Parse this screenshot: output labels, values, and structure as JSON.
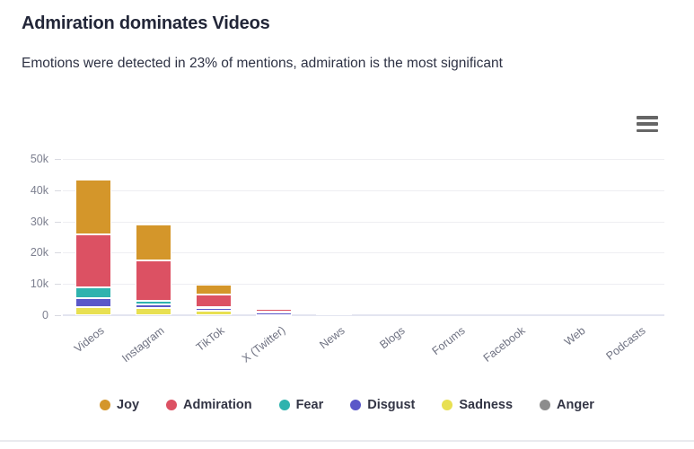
{
  "card": {
    "title": "Admiration dominates Videos",
    "subtitle": "Emotions were detected in 23% of mentions, admiration is the most significant",
    "menu_icon": "hamburger-menu-icon"
  },
  "chart_data": {
    "type": "bar",
    "stacked": true,
    "title": "Admiration dominates Videos",
    "subtitle": "Emotions were detected in 23% of mentions, admiration is the most significant",
    "xlabel": "",
    "ylabel": "",
    "ylim": [
      0,
      50000
    ],
    "yticks": [
      0,
      10000,
      20000,
      30000,
      40000,
      50000
    ],
    "ytick_labels": [
      "0",
      "10k",
      "20k",
      "30k",
      "40k",
      "50k"
    ],
    "grid": true,
    "legend_position": "bottom",
    "categories": [
      "Videos",
      "Instagram",
      "TikTok",
      "X (Twitter)",
      "News",
      "Blogs",
      "Forums",
      "Facebook",
      "Web",
      "Podcasts"
    ],
    "series": [
      {
        "name": "Joy",
        "color": "#D4962A",
        "values": [
          17600,
          11500,
          3100,
          200,
          0,
          0,
          0,
          0,
          0,
          0
        ]
      },
      {
        "name": "Admiration",
        "color": "#DC5163",
        "values": [
          17100,
          12800,
          3900,
          900,
          700,
          0,
          0,
          0,
          0,
          0
        ]
      },
      {
        "name": "Fear",
        "color": "#2FB3AE",
        "values": [
          3200,
          1100,
          500,
          100,
          0,
          0,
          0,
          0,
          0,
          0
        ]
      },
      {
        "name": "Disgust",
        "color": "#5A58C8",
        "values": [
          3000,
          1300,
          900,
          900,
          0,
          0,
          0,
          0,
          0,
          0
        ]
      },
      {
        "name": "Sadness",
        "color": "#E8E052",
        "values": [
          2600,
          2200,
          1300,
          100,
          0,
          0,
          0,
          0,
          0,
          0
        ]
      },
      {
        "name": "Anger",
        "color": "#8C8C8C",
        "values": [
          0,
          0,
          0,
          0,
          0,
          0,
          0,
          0,
          0,
          0
        ]
      }
    ]
  },
  "legend": [
    {
      "label": "Joy",
      "color": "#D4962A"
    },
    {
      "label": "Admiration",
      "color": "#DC5163"
    },
    {
      "label": "Fear",
      "color": "#2FB3AE"
    },
    {
      "label": "Disgust",
      "color": "#5A58C8"
    },
    {
      "label": "Sadness",
      "color": "#E8E052"
    },
    {
      "label": "Anger",
      "color": "#8C8C8C"
    }
  ]
}
